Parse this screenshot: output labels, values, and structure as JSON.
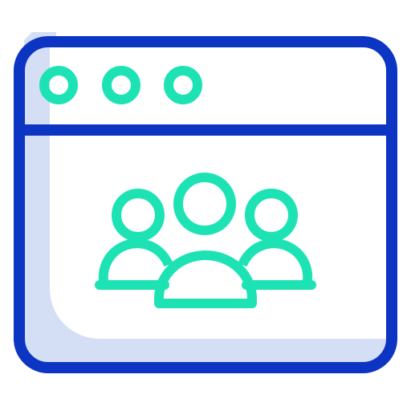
{
  "icon": {
    "name": "browser-window-community-icon",
    "colors": {
      "frame": "#0b35c2",
      "shade": "#d4def4",
      "accent": "#1de3b4",
      "background": "#ffffff"
    },
    "window_buttons": [
      "dot-1",
      "dot-2",
      "dot-3"
    ],
    "people_count": 3
  }
}
